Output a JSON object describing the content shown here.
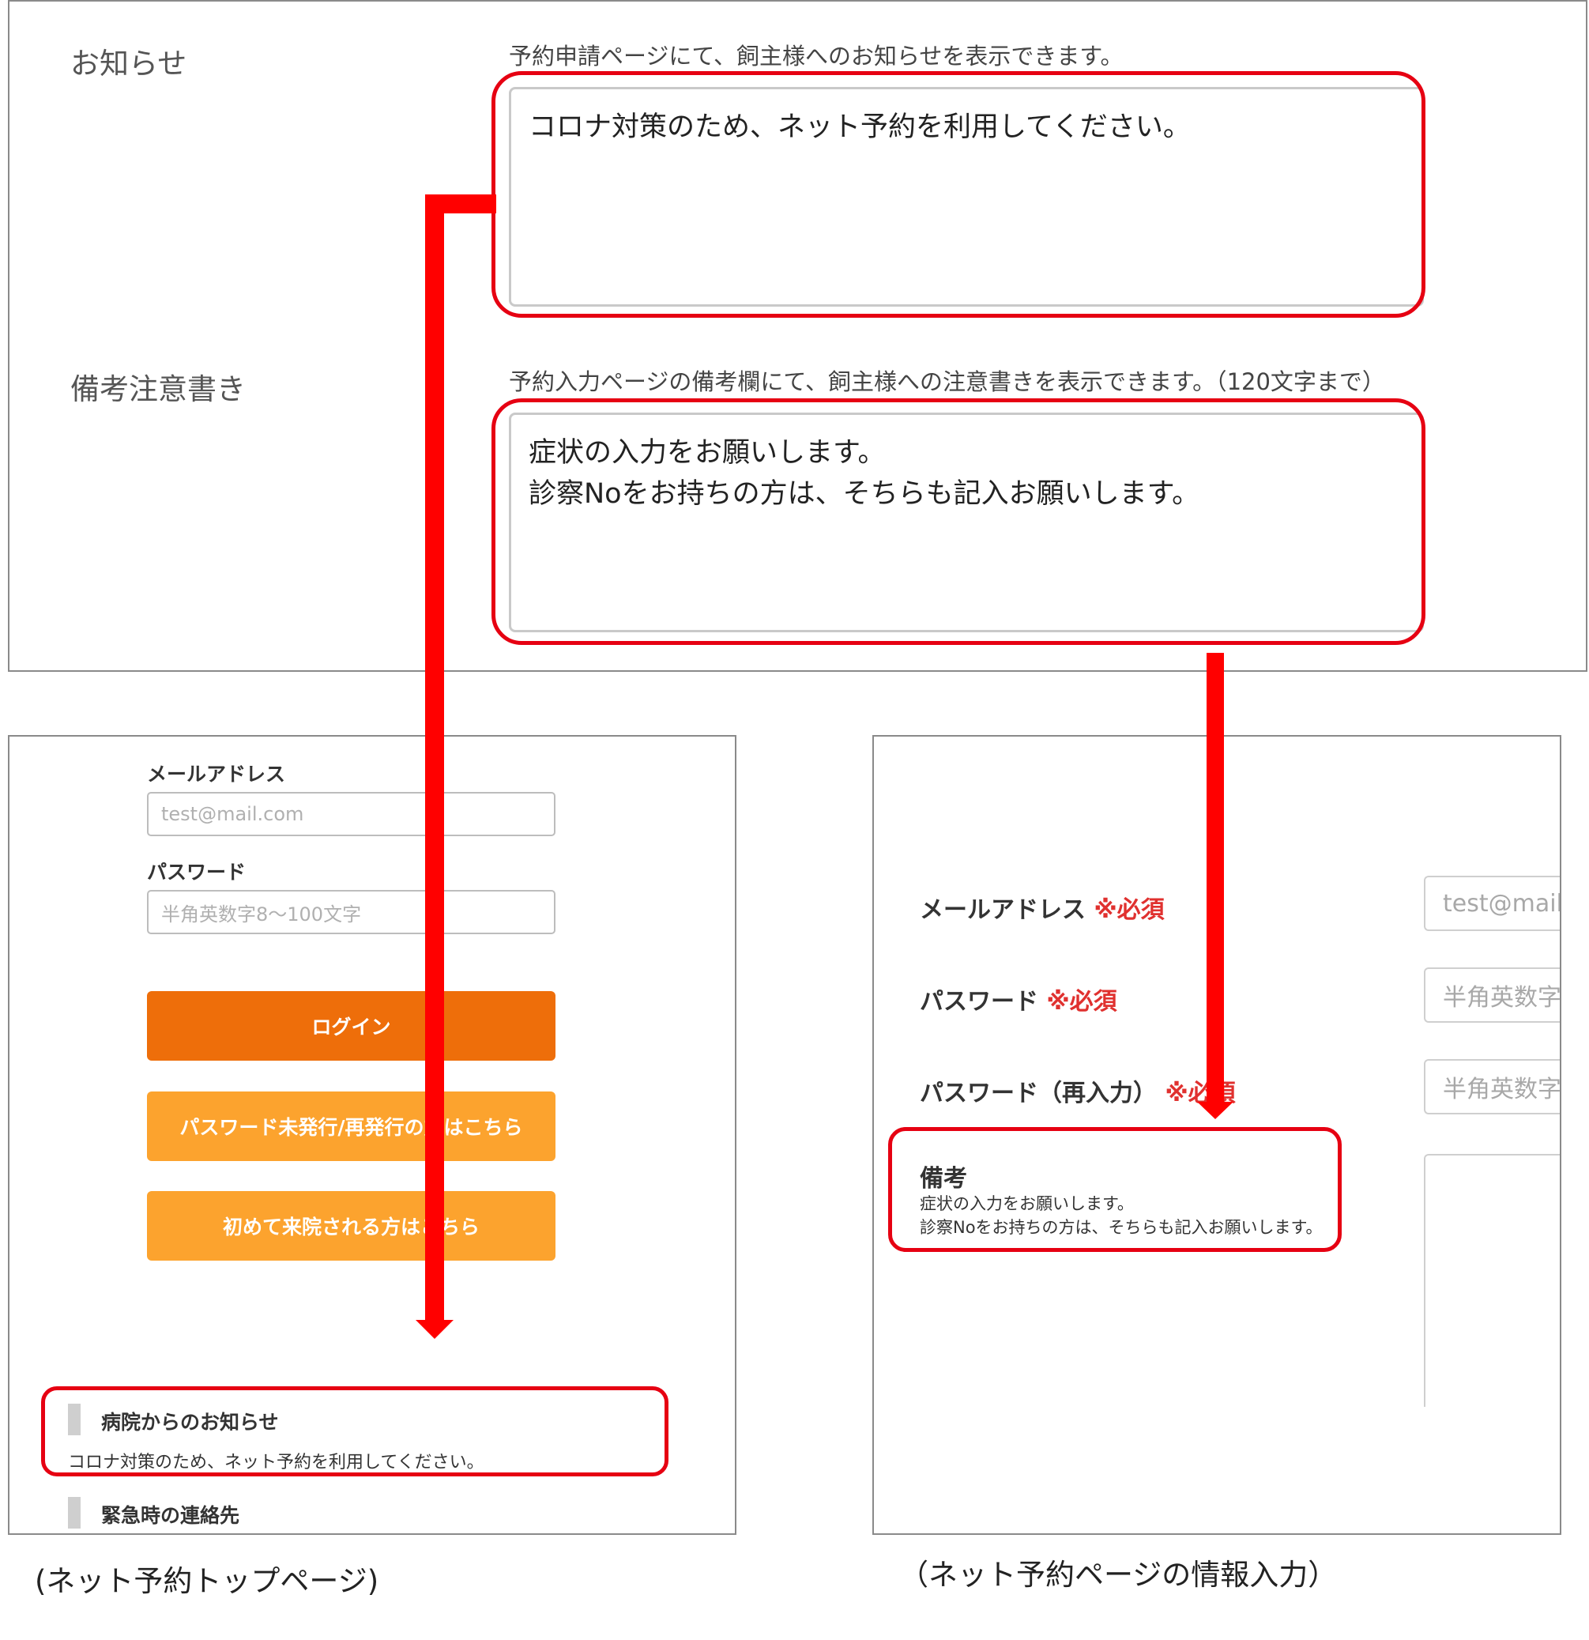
{
  "settings": {
    "notice": {
      "label": "お知らせ",
      "description": "予約申請ページにて、飼主様へのお知らせを表示できます。",
      "value": "コロナ対策のため、ネット予約を利用してください。"
    },
    "remarks": {
      "label": "備考注意書き",
      "description": "予約入力ページの備考欄にて、飼主様への注意書きを表示できます。（120文字まで）",
      "value_line1": "症状の入力をお願いします。",
      "value_line2": "診察Noをお持ちの方は、そちらも記入お願いします。"
    }
  },
  "top_page": {
    "email_label": "メールアドレス",
    "email_placeholder": "test@mail.com",
    "password_label": "パスワード",
    "password_placeholder": "半角英数字8〜100文字",
    "login_button": "ログイン",
    "password_reissue_button": "パスワード未発行/再発行の方はこちら",
    "first_visit_button": "初めて来院される方はこちら",
    "hospital_notice_title": "病院からのお知らせ",
    "hospital_notice_body": "コロナ対策のため、ネット予約を利用してください。",
    "emergency_contact_title": "緊急時の連絡先",
    "caption": "(ネット予約トップページ)"
  },
  "reservation_page": {
    "email_label": "メールアドレス",
    "required_mark": "※必須",
    "email_placeholder": "test@mail.com",
    "password_label": "パスワード",
    "password_placeholder": "半角英数字",
    "password_confirm_label": "パスワード（再入力）",
    "password_confirm_placeholder": "半角英数字",
    "remarks_title": "備考",
    "remarks_line1": "症状の入力をお願いします。",
    "remarks_line2": "診察Noをお持ちの方は、そちらも記入お願いします。",
    "caption": "（ネット予約ページの情報入力）"
  },
  "colors": {
    "highlight": "#e60012",
    "arrow": "#ff0000",
    "login_button": "#ee6e0a",
    "secondary_button": "#fca32e",
    "required": "#e0312f"
  }
}
